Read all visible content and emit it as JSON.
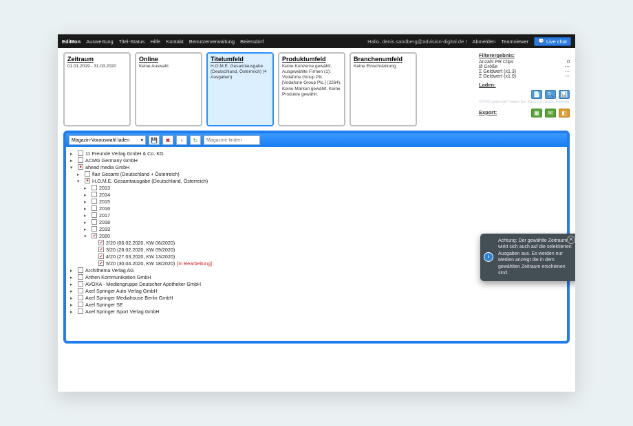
{
  "app": {
    "name": "EdiMon"
  },
  "nav": {
    "left": [
      "Auswertung",
      "Titel-Status",
      "Hilfe",
      "Kontakt",
      "Benutzerverwaltung",
      "Beiersdorf"
    ],
    "greeting": "Hallo, denis.sandberg@advision-digital.de !",
    "logout": "Abmelden",
    "teamviewer": "Teamviewer",
    "livechat": "Live chat"
  },
  "filters": {
    "zeitraum": {
      "title": "Zeitraum",
      "body": "01.01.2019 - 31.03.2020"
    },
    "online": {
      "title": "Online",
      "body": "Keine Auswahl"
    },
    "titel": {
      "title": "Titelumfeld",
      "body": "H.O.M.E. Gesamtausgabe (Deutschland, Österreich) (4 Ausgaben)"
    },
    "produkt": {
      "title": "Produktumfeld",
      "body": "Keine Konzerne gewählt. Ausgewählte Firmen (1): Vodafone Group Plc. [Vodafone Group Plc.] (2264). Keine Marken gewählt. Keine Produkte gewählt."
    },
    "branche": {
      "title": "Branchenumfeld",
      "body": "Keine Einschränkung"
    }
  },
  "stats": {
    "header": "Filterergebnis:",
    "rows": [
      {
        "label": "Anzahl PR Clips",
        "value": "0"
      },
      {
        "label": "Ø Größe",
        "value": "---"
      },
      {
        "label": "Σ Geldwert (x1.3)",
        "value": "---"
      },
      {
        "label": "Σ Geldwert (x1.0)",
        "value": "---"
      }
    ],
    "laden": "Laden:",
    "hint": "STRG gedrückt halten bei Klick für neues Fenster",
    "export": "Export:"
  },
  "toolbar": {
    "preset_label": "Magazin-Vorauswahl laden",
    "search_placeholder": "Magazine finden"
  },
  "tree": {
    "nodes": [
      {
        "label": "11 Freunde Verlag GmbH & Co. KG",
        "checked": false,
        "depth": 0,
        "expander": "▸"
      },
      {
        "label": "ACMG Germany GmbH",
        "checked": false,
        "depth": 0,
        "expander": "▸"
      },
      {
        "label": "ahead media GmbH",
        "checked": "partial",
        "depth": 0,
        "expander": "▾"
      },
      {
        "label": "flair Gesamt (Deutschland + Österreich)",
        "checked": false,
        "depth": 1,
        "expander": "▸"
      },
      {
        "label": "H.O.M.E. Gesamtausgabe (Deutschland, Österreich)",
        "checked": "partial",
        "depth": 1,
        "expander": "▾"
      },
      {
        "label": "2013",
        "checked": false,
        "depth": 2,
        "expander": "▸"
      },
      {
        "label": "2014",
        "checked": false,
        "depth": 2,
        "expander": "▸"
      },
      {
        "label": "2015",
        "checked": false,
        "depth": 2,
        "expander": "▸"
      },
      {
        "label": "2016",
        "checked": false,
        "depth": 2,
        "expander": "▸"
      },
      {
        "label": "2017",
        "checked": false,
        "depth": 2,
        "expander": "▸"
      },
      {
        "label": "2018",
        "checked": false,
        "depth": 2,
        "expander": "▸"
      },
      {
        "label": "2019",
        "checked": false,
        "depth": 2,
        "expander": "▸"
      },
      {
        "label": "2020",
        "checked": true,
        "depth": 2,
        "expander": "▾"
      },
      {
        "label": "2/20 (06.02.2020, KW 06/2020)",
        "checked": true,
        "depth": 3,
        "expander": ""
      },
      {
        "label": "3/20 (28.02.2020, KW 09/2020)",
        "checked": true,
        "depth": 3,
        "expander": ""
      },
      {
        "label": "4/20 (27.03.2020, KW 13/2020)",
        "checked": true,
        "depth": 3,
        "expander": ""
      },
      {
        "label": "5/20 (30.04.2020, KW 18/2020)",
        "checked": true,
        "depth": 3,
        "expander": "",
        "suffix": "[In Bearbeitung]"
      },
      {
        "label": "Archithema Verlag AG",
        "checked": false,
        "depth": 0,
        "expander": "▸"
      },
      {
        "label": "Arthen Kommunikation GmbH",
        "checked": false,
        "depth": 0,
        "expander": "▸"
      },
      {
        "label": "AVOXA - Mediengruppe Deutscher Apotheker GmbH",
        "checked": false,
        "depth": 0,
        "expander": "▸"
      },
      {
        "label": "Axel Springer Auto Verlag GmbH",
        "checked": false,
        "depth": 0,
        "expander": "▸"
      },
      {
        "label": "Axel Springer Mediahouse Berlin GmbH",
        "checked": false,
        "depth": 0,
        "expander": "▸"
      },
      {
        "label": "Axel Springer SE",
        "checked": false,
        "depth": 0,
        "expander": "▸"
      },
      {
        "label": "Axel Springer Sport Verlag GmbH",
        "checked": false,
        "depth": 0,
        "expander": "▸"
      }
    ]
  },
  "tooltip": {
    "text": "Achtung: Der gewählte Zeitraum wirkt sich auch auf die selektierten Ausgaben aus. Es werden nur Medien anzeigt die in dem gewählten Zeitraum erschienen sind."
  }
}
